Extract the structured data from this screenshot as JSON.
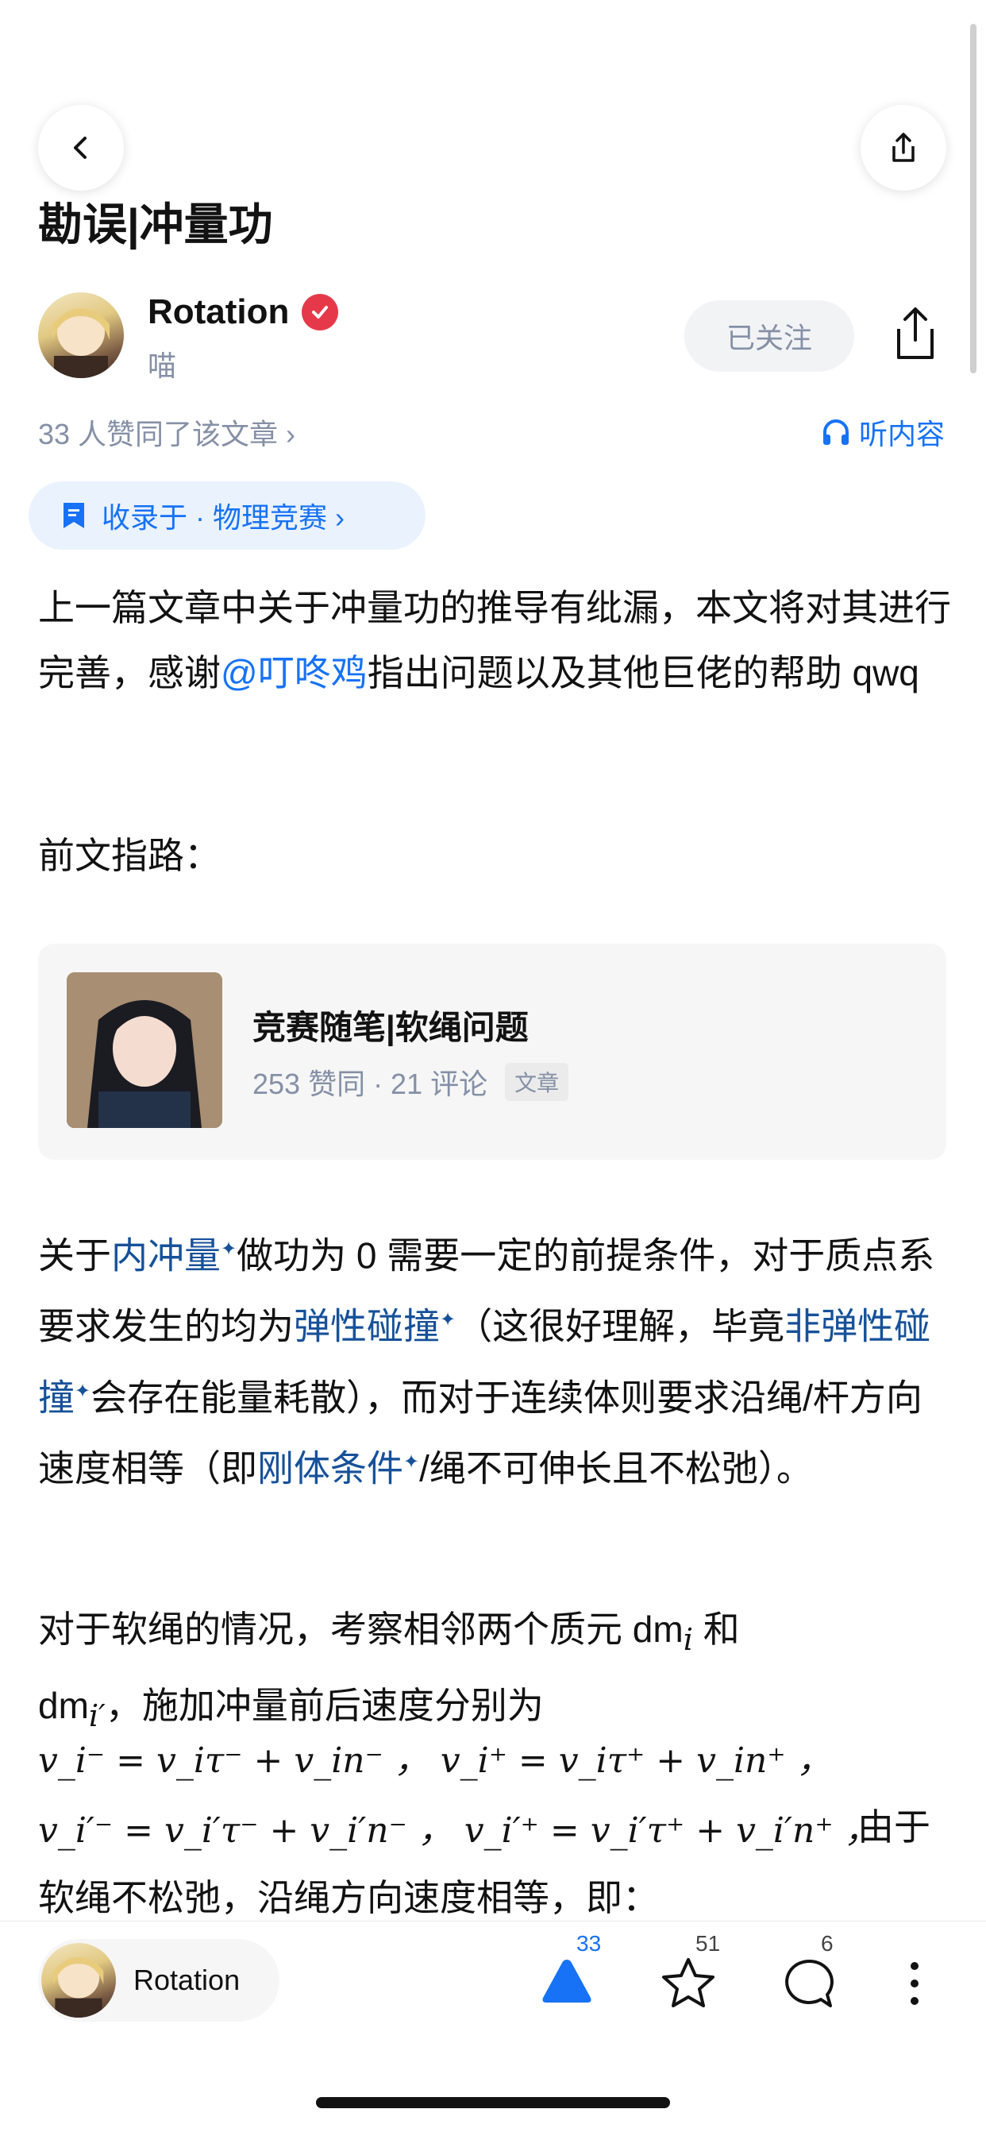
{
  "header": {
    "title": "勘误|冲量功",
    "back_icon": "chevron-left-icon",
    "share_icon": "share-icon"
  },
  "author": {
    "name": "Rotation",
    "subtitle": "喵",
    "follow_label": "已关注",
    "verified_icon": "verified-badge-icon"
  },
  "meta": {
    "likes_text": "33 人赞同了该文章 ›",
    "listen_label": "听内容"
  },
  "collection": {
    "label": "收录于 · 物理竞赛 ›"
  },
  "article": {
    "intro_a": "上一篇文章中关于冲量功的推导有纰漏，本文将对其进行完善，感谢",
    "mention": "@叮咚鸡",
    "intro_b": "指出问题以及其他巨佬的帮助 qwq",
    "prev_label": "前文指路：",
    "p2_a": "关于",
    "p2_link1": "内冲量",
    "p2_b": "做功为 0 需要一定的前提条件，对于质点系要求发生的均为",
    "p2_link2": "弹性碰撞",
    "p2_c": "（这很好理解，毕竟",
    "p2_link3": "非弹性碰撞",
    "p2_d": "会存在能量耗散），而对于连续体则要求沿绳/杆方向速度相等（即",
    "p2_link4": "刚体条件",
    "p2_e": "/绳不可伸长且不松弛）。",
    "p3_a": "对于软绳的情况，考察相邻两个质元 dm",
    "p3_sub_i": "i",
    "p3_b": " 和",
    "p3_c": "dm",
    "p3_sub_ip": "i′",
    "p3_d": "，施加冲量前后速度分别为",
    "eq1": "v_i⁻ = v_iτ⁻ + v_in⁻ ，  v_i⁺ = v_iτ⁺ + v_in⁺ ，",
    "eq2": "v_i′⁻ = v_i′τ⁻ + v_i′n⁻ ，  v_i′⁺ = v_i′τ⁺ + v_i′n⁺ ，",
    "eq2_tail": "由于",
    "p4": "软绳不松弛，沿绳方向速度相等，即："
  },
  "linked_card": {
    "title": "竞赛随笔|软绳问题",
    "stats": "253 赞同 · 21 评论",
    "tag": "文章"
  },
  "bottom": {
    "author_name": "Rotation",
    "upvote_count": "33",
    "star_count": "51",
    "comment_count": "6",
    "upvote_icon": "upvote-triangle-icon",
    "star_icon": "star-icon",
    "comment_icon": "comment-bubble-icon",
    "more_icon": "more-vertical-icon"
  },
  "colors": {
    "accent": "#1772f6",
    "link": "#175199",
    "muted": "#8590a6"
  }
}
